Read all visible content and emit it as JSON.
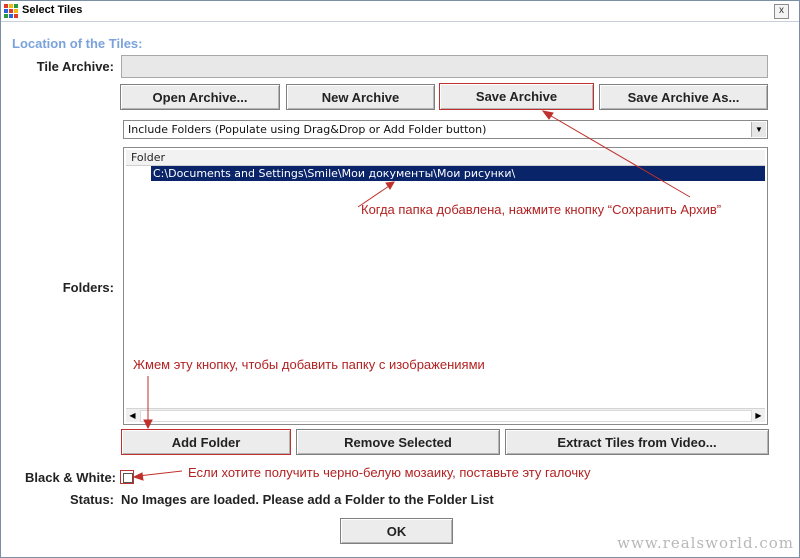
{
  "window": {
    "title": "Select Tiles",
    "close_label": "x"
  },
  "section_title": "Location of the Tiles:",
  "labels": {
    "tile_archive": "Tile Archive:",
    "folders": "Folders:",
    "black_white": "Black & White:",
    "status": "Status:"
  },
  "tile_archive": {
    "value": ""
  },
  "archive_buttons": {
    "open": "Open Archive...",
    "new": "New Archive",
    "save": "Save Archive",
    "save_as": "Save Archive As..."
  },
  "folder_mode_select": {
    "value": "Include Folders (Populate using Drag&Drop or Add Folder button)"
  },
  "folder_list": {
    "column_header": "Folder",
    "rows": [
      "C:\\Documents and Settings\\Smile\\Мои документы\\Мои рисунки\\"
    ]
  },
  "folder_buttons": {
    "add": "Add Folder",
    "remove": "Remove Selected",
    "extract": "Extract Tiles from Video..."
  },
  "black_white_checked": false,
  "status_text": "No Images are loaded. Please add a Folder to the Folder List",
  "ok_label": "OK",
  "annotations": {
    "save_hint": "Когда папка добавлена, нажмите кнопку “Сохранить Архив”",
    "add_hint": "Жмем эту кнопку, чтобы добавить папку с изображениями",
    "bw_hint": "Если хотите получить черно-белую мозаику, поставьте эту галочку"
  },
  "watermark": "www.realsworld.com",
  "colors": {
    "section_title": "#7aa2dc",
    "annotation": "#b22222",
    "selection": "#0a246a"
  }
}
